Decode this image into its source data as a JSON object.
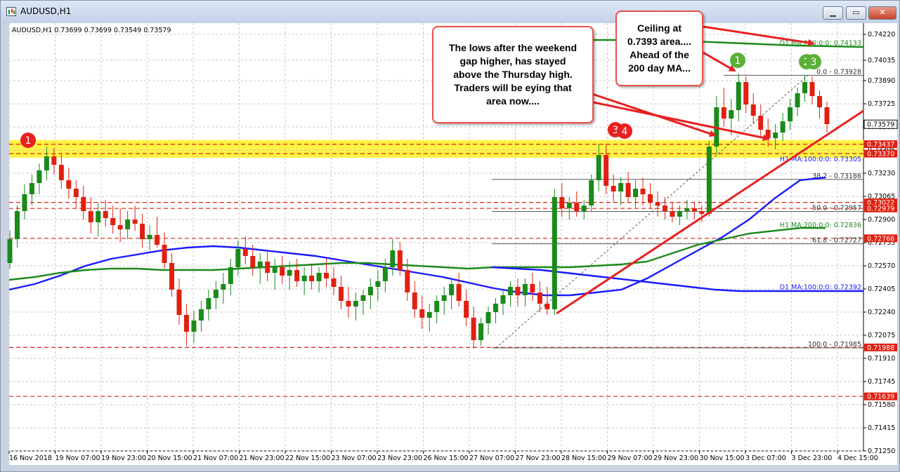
{
  "window": {
    "title": "AUDUSD,H1",
    "buttons": {
      "minimize": "▁",
      "restore": "▭",
      "close": "✕"
    }
  },
  "header": {
    "text": "AUDUSD,H1  0.73699 0.73699 0.73549 0.73579"
  },
  "chart_data": {
    "type": "candlestick",
    "symbol": "AUDUSD",
    "timeframe": "H1",
    "ylim": [
      0.7125,
      0.743
    ],
    "y_ticks": [
      "0.74220",
      "0.74035",
      "0.73890",
      "0.73725",
      "0.73560",
      "0.73395",
      "0.73230",
      "0.73065",
      "0.72900",
      "0.72735",
      "0.72570",
      "0.72405",
      "0.72240",
      "0.72075",
      "0.71910",
      "0.71745",
      "0.71580",
      "0.71415",
      "0.71250"
    ],
    "x_ticks": [
      "16 Nov 2018",
      "19 Nov 07:00",
      "19 Nov 23:00",
      "20 Nov 15:00",
      "21 Nov 07:00",
      "21 Nov 23:00",
      "22 Nov 15:00",
      "23 Nov 07:00",
      "23 Nov 23:00",
      "26 Nov 15:00",
      "27 Nov 07:00",
      "27 Nov 23:00",
      "28 Nov 15:00",
      "29 Nov 07:00",
      "29 Nov 23:00",
      "30 Nov 15:00",
      "3 Dec 07:00",
      "3 Dec 23:00",
      "4 Dec 15:00"
    ],
    "bid_price": "0.73579",
    "price_lines": [
      {
        "name": "D1 MA:200:0:0",
        "value": 0.74133,
        "label": "D1 MA:200:0:0: 0.74133",
        "color": "#1a8a1a"
      },
      {
        "name": "Fibo 0.0",
        "value": 0.73928,
        "label": "0.0 - 0.73928",
        "color": "#333333"
      },
      {
        "name": "H1 MA:100:0:0",
        "value": 0.73305,
        "label": "H1 MA:100:0:0: 0.73305",
        "color": "#1a1aff"
      },
      {
        "name": "Fibo 38.2",
        "value": 0.73186,
        "label": "38.2 - 0.73186",
        "color": "#333333"
      },
      {
        "name": "Fibo 50.0",
        "value": 0.72957,
        "label": "50.0 - 0.72957",
        "color": "#333333"
      },
      {
        "name": "H1 MA:200:0:0",
        "value": 0.72836,
        "label": "H1 MA:200:0:0: 0.72836",
        "color": "#1a8a1a"
      },
      {
        "name": "Fibo 61.8",
        "value": 0.72727,
        "label": "61.8 - 0.72727",
        "color": "#333333"
      },
      {
        "name": "D1 MA:100:0:0",
        "value": 0.72392,
        "label": "D1 MA:100:0:0: 0.72392",
        "color": "#1a1aff"
      },
      {
        "name": "Fibo 100.0",
        "value": 0.71985,
        "label": "100.0 - 0.71985",
        "color": "#333333"
      }
    ],
    "red_levels": [
      {
        "value": 0.73437,
        "label": "0.73437"
      },
      {
        "value": 0.7337,
        "label": "0.73370"
      },
      {
        "value": 0.73022,
        "label": "0.73022"
      },
      {
        "value": 0.72979,
        "label": "0.72979"
      },
      {
        "value": 0.72766,
        "label": "0.72766"
      },
      {
        "value": 0.71988,
        "label": "0.71988"
      },
      {
        "value": 0.71639,
        "label": "0.71639"
      }
    ],
    "support_zone": [
      0.7337,
      0.73437
    ],
    "candles": [
      [
        0.7259,
        0.7282,
        0.7255,
        0.7276
      ],
      [
        0.7276,
        0.73,
        0.727,
        0.7296
      ],
      [
        0.7296,
        0.7315,
        0.729,
        0.7308
      ],
      [
        0.7308,
        0.7322,
        0.73,
        0.7316
      ],
      [
        0.7316,
        0.733,
        0.7308,
        0.7325
      ],
      [
        0.7325,
        0.7342,
        0.7318,
        0.7335
      ],
      [
        0.7335,
        0.7341,
        0.7322,
        0.7329
      ],
      [
        0.7329,
        0.7336,
        0.7312,
        0.7318
      ],
      [
        0.7318,
        0.7327,
        0.7305,
        0.7312
      ],
      [
        0.7312,
        0.7318,
        0.7298,
        0.7306
      ],
      [
        0.7306,
        0.7314,
        0.729,
        0.7296
      ],
      [
        0.7296,
        0.7306,
        0.728,
        0.7288
      ],
      [
        0.7288,
        0.7302,
        0.7278,
        0.7296
      ],
      [
        0.7296,
        0.7304,
        0.7285,
        0.7291
      ],
      [
        0.7291,
        0.73,
        0.728,
        0.7286
      ],
      [
        0.7286,
        0.7298,
        0.7274,
        0.7283
      ],
      [
        0.7283,
        0.7296,
        0.7276,
        0.729
      ],
      [
        0.729,
        0.73,
        0.7282,
        0.7287
      ],
      [
        0.7287,
        0.7294,
        0.727,
        0.7276
      ],
      [
        0.7276,
        0.7286,
        0.7268,
        0.7279
      ],
      [
        0.7279,
        0.7292,
        0.727,
        0.7272
      ],
      [
        0.7272,
        0.7281,
        0.7255,
        0.7259
      ],
      [
        0.7259,
        0.7266,
        0.7235,
        0.724
      ],
      [
        0.724,
        0.7248,
        0.7215,
        0.7222
      ],
      [
        0.7222,
        0.723,
        0.72,
        0.721
      ],
      [
        0.721,
        0.7225,
        0.7202,
        0.7218
      ],
      [
        0.7218,
        0.7232,
        0.721,
        0.7226
      ],
      [
        0.7226,
        0.724,
        0.7218,
        0.7234
      ],
      [
        0.7234,
        0.7246,
        0.7226,
        0.724
      ],
      [
        0.724,
        0.7252,
        0.723,
        0.7244
      ],
      [
        0.7244,
        0.7262,
        0.7236,
        0.7256
      ],
      [
        0.7256,
        0.7275,
        0.725,
        0.7269
      ],
      [
        0.7269,
        0.7278,
        0.7258,
        0.7264
      ],
      [
        0.7264,
        0.7272,
        0.725,
        0.7256
      ],
      [
        0.7256,
        0.7266,
        0.7244,
        0.726
      ],
      [
        0.726,
        0.7268,
        0.7246,
        0.7252
      ],
      [
        0.7252,
        0.7262,
        0.724,
        0.7256
      ],
      [
        0.7256,
        0.7264,
        0.7244,
        0.725
      ],
      [
        0.725,
        0.726,
        0.724,
        0.7254
      ],
      [
        0.7254,
        0.7262,
        0.7242,
        0.7246
      ],
      [
        0.7246,
        0.7256,
        0.7236,
        0.725
      ],
      [
        0.725,
        0.7258,
        0.724,
        0.7246
      ],
      [
        0.7246,
        0.7256,
        0.7238,
        0.7252
      ],
      [
        0.7252,
        0.7262,
        0.7242,
        0.7248
      ],
      [
        0.7248,
        0.7256,
        0.7236,
        0.7242
      ],
      [
        0.7242,
        0.725,
        0.7226,
        0.7232
      ],
      [
        0.7232,
        0.7242,
        0.722,
        0.7228
      ],
      [
        0.7228,
        0.7238,
        0.7218,
        0.7232
      ],
      [
        0.7232,
        0.724,
        0.7222,
        0.7236
      ],
      [
        0.7236,
        0.7248,
        0.7226,
        0.7242
      ],
      [
        0.7242,
        0.7254,
        0.7232,
        0.7246
      ],
      [
        0.7246,
        0.7262,
        0.7238,
        0.7256
      ],
      [
        0.7256,
        0.7276,
        0.725,
        0.7268
      ],
      [
        0.7268,
        0.7274,
        0.725,
        0.7254
      ],
      [
        0.7254,
        0.7262,
        0.7232,
        0.7238
      ],
      [
        0.7238,
        0.7246,
        0.722,
        0.7226
      ],
      [
        0.7226,
        0.7236,
        0.7212,
        0.722
      ],
      [
        0.722,
        0.723,
        0.721,
        0.7224
      ],
      [
        0.7224,
        0.7236,
        0.7216,
        0.7232
      ],
      [
        0.7232,
        0.7242,
        0.7222,
        0.7236
      ],
      [
        0.7236,
        0.7248,
        0.7226,
        0.7244
      ],
      [
        0.7244,
        0.7252,
        0.7228,
        0.7232
      ],
      [
        0.7232,
        0.724,
        0.7214,
        0.722
      ],
      [
        0.722,
        0.7228,
        0.7198,
        0.7204
      ],
      [
        0.7204,
        0.722,
        0.72,
        0.7216
      ],
      [
        0.7216,
        0.7228,
        0.7208,
        0.7224
      ],
      [
        0.7224,
        0.7234,
        0.7216,
        0.723
      ],
      [
        0.723,
        0.724,
        0.7222,
        0.7236
      ],
      [
        0.7236,
        0.7246,
        0.7228,
        0.7242
      ],
      [
        0.7242,
        0.7248,
        0.7228,
        0.7236
      ],
      [
        0.7236,
        0.7248,
        0.7228,
        0.7244
      ],
      [
        0.7244,
        0.7252,
        0.7232,
        0.7238
      ],
      [
        0.7238,
        0.7246,
        0.7224,
        0.723
      ],
      [
        0.723,
        0.7242,
        0.7222,
        0.7226
      ],
      [
        0.7226,
        0.7312,
        0.7222,
        0.7306
      ],
      [
        0.7306,
        0.7316,
        0.7292,
        0.7298
      ],
      [
        0.7298,
        0.7306,
        0.729,
        0.7302
      ],
      [
        0.7302,
        0.731,
        0.7292,
        0.7296
      ],
      [
        0.7296,
        0.7304,
        0.729,
        0.73
      ],
      [
        0.73,
        0.7322,
        0.7296,
        0.7318
      ],
      [
        0.7318,
        0.7344,
        0.731,
        0.7336
      ],
      [
        0.7336,
        0.7344,
        0.7308,
        0.7314
      ],
      [
        0.7314,
        0.7322,
        0.7302,
        0.731
      ],
      [
        0.731,
        0.732,
        0.73,
        0.7316
      ],
      [
        0.7316,
        0.7324,
        0.7302,
        0.7306
      ],
      [
        0.7306,
        0.7318,
        0.7298,
        0.7312
      ],
      [
        0.7312,
        0.732,
        0.73,
        0.7308
      ],
      [
        0.7308,
        0.7316,
        0.7298,
        0.7302
      ],
      [
        0.7302,
        0.731,
        0.7292,
        0.73
      ],
      [
        0.73,
        0.7306,
        0.729,
        0.7296
      ],
      [
        0.7296,
        0.7302,
        0.7288,
        0.7292
      ],
      [
        0.7292,
        0.73,
        0.7286,
        0.7296
      ],
      [
        0.7296,
        0.7304,
        0.729,
        0.7298
      ],
      [
        0.7298,
        0.7302,
        0.729,
        0.7296
      ],
      [
        0.7296,
        0.73,
        0.7288,
        0.7294
      ],
      [
        0.7294,
        0.7346,
        0.7292,
        0.7342
      ],
      [
        0.7342,
        0.7378,
        0.7336,
        0.737
      ],
      [
        0.737,
        0.7384,
        0.7356,
        0.7362
      ],
      [
        0.7362,
        0.7376,
        0.735,
        0.7368
      ],
      [
        0.7368,
        0.7394,
        0.736,
        0.7388
      ],
      [
        0.7388,
        0.7392,
        0.7366,
        0.7372
      ],
      [
        0.7372,
        0.738,
        0.7358,
        0.7364
      ],
      [
        0.7364,
        0.7372,
        0.7348,
        0.7354
      ],
      [
        0.7354,
        0.7362,
        0.7342,
        0.7348
      ],
      [
        0.7348,
        0.7358,
        0.734,
        0.7352
      ],
      [
        0.7352,
        0.7366,
        0.7346,
        0.736
      ],
      [
        0.736,
        0.7376,
        0.7354,
        0.737
      ],
      [
        0.737,
        0.7384,
        0.7364,
        0.738
      ],
      [
        0.738,
        0.7393,
        0.7374,
        0.7388
      ],
      [
        0.7388,
        0.7392,
        0.7372,
        0.7378
      ],
      [
        0.7378,
        0.7382,
        0.7362,
        0.737
      ],
      [
        0.737,
        0.7374,
        0.7352,
        0.7358
      ]
    ],
    "ma_h1_100": [
      0.724,
      0.7244,
      0.725,
      0.7257,
      0.7262,
      0.7265,
      0.7268,
      0.727,
      0.7271,
      0.727,
      0.7268,
      0.7266,
      0.7264,
      0.7261,
      0.7258,
      0.7255,
      0.7252,
      0.7249,
      0.7245,
      0.7241,
      0.7238,
      0.7236,
      0.7236,
      0.7238,
      0.724,
      0.7248,
      0.7258,
      0.7268,
      0.7278,
      0.729,
      0.7305,
      0.7318,
      0.732
    ],
    "ma_h1_200": [
      0.7247,
      0.7249,
      0.7252,
      0.7254,
      0.7255,
      0.7255,
      0.7254,
      0.7254,
      0.7254,
      0.7255,
      0.7256,
      0.7257,
      0.7258,
      0.7259,
      0.7259,
      0.7258,
      0.7257,
      0.7256,
      0.7255,
      0.7256,
      0.7256,
      0.7256,
      0.7256,
      0.7257,
      0.7258,
      0.726,
      0.7266,
      0.7272,
      0.7276,
      0.728,
      0.7282,
      0.7284,
      0.7284
    ],
    "ma_d1_100": [
      0.7256,
      0.7255,
      0.7254,
      0.7252,
      0.725,
      0.7248,
      0.7246,
      0.7244,
      0.7242,
      0.724,
      0.7239,
      0.7239,
      0.7239,
      0.7239,
      0.7239,
      0.7239
    ],
    "ma_d1_200": [
      0.7418,
      0.7418,
      0.7416,
      0.7414,
      0.7413
    ]
  },
  "markers": [
    {
      "id": "marker-1-left",
      "text": "1",
      "color": "#e82020"
    },
    {
      "id": "marker-3-4-a",
      "text": "3",
      "color": "#e82020"
    },
    {
      "id": "marker-3-4-b",
      "text": "4",
      "color": "#e82020"
    },
    {
      "id": "marker-1-right",
      "text": "1",
      "color": "#5bb037"
    },
    {
      "id": "marker-2",
      "text": "2",
      "color": "#5bb037"
    },
    {
      "id": "marker-3",
      "text": "3",
      "color": "#5bb037"
    }
  ],
  "annotations": {
    "lows": [
      "The lows after the weekend",
      "gap higher, has stayed",
      "above the Thursday high.",
      "Traders will be eying that",
      "area now...."
    ],
    "ceiling": [
      "Ceiling at",
      "0.7393 area....",
      "Ahead of the",
      "200 day MA..."
    ]
  },
  "colors": {
    "bull": "#1a8a1a",
    "bear": "#e02010",
    "ma_blue": "#1a1aff",
    "ma_green": "#1a8a1a",
    "zone": "#fff23a",
    "trend": "#e82020"
  }
}
